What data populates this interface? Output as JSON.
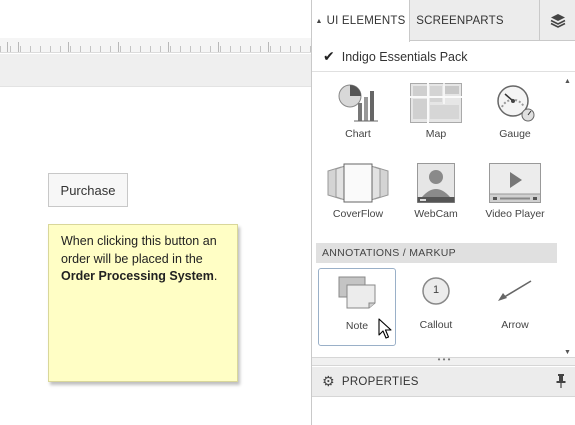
{
  "canvas": {
    "button_label": "Purchase",
    "note": {
      "text_1": "When clicking this button an order will be placed in the ",
      "bold": "Order Processing System",
      "text_2": "."
    }
  },
  "panel": {
    "tabs": [
      {
        "label": "UI ELEMENTS",
        "active": true
      },
      {
        "label": "SCREENPARTS",
        "active": false
      }
    ],
    "layers_icon": "layers-icon",
    "pack_title": "Indigo Essentials Pack",
    "items_row1": [
      {
        "label": "Chart",
        "icon": "chart-icon"
      },
      {
        "label": "Map",
        "icon": "map-icon"
      },
      {
        "label": "Gauge",
        "icon": "gauge-icon"
      }
    ],
    "items_row2": [
      {
        "label": "CoverFlow",
        "icon": "coverflow-icon"
      },
      {
        "label": "WebCam",
        "icon": "webcam-icon"
      },
      {
        "label": "Video Player",
        "icon": "video-player-icon"
      }
    ],
    "annotations_header": "ANNOTATIONS / MARKUP",
    "items_row3": [
      {
        "label": "Note",
        "icon": "note-icon",
        "selected": true
      },
      {
        "label": "Callout",
        "icon": "callout-icon",
        "badge": "1"
      },
      {
        "label": "Arrow",
        "icon": "arrow-icon"
      }
    ],
    "properties_title": "PROPERTIES",
    "colors": {
      "selection_border": "#9ab0c8",
      "note_bg": "#fffec5",
      "section_bg": "#e0e0e0"
    }
  }
}
